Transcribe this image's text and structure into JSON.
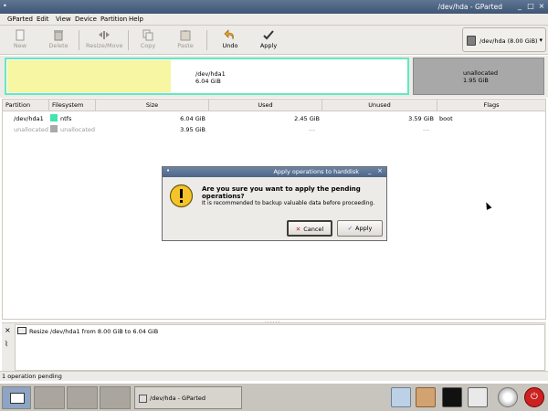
{
  "window": {
    "title": "/dev/hda - GParted"
  },
  "menu": [
    "GParted",
    "Edit",
    "View",
    "Device",
    "Partition",
    "Help"
  ],
  "toolbar": {
    "new": "New",
    "delete": "Delete",
    "resize": "Resize/Move",
    "copy": "Copy",
    "paste": "Paste",
    "undo": "Undo",
    "apply": "Apply"
  },
  "device_selector": {
    "label": "/dev/hda   (8.00 GiB)"
  },
  "graph": {
    "part1": {
      "name": "/dev/hda1",
      "size": "6.04 GiB",
      "used_fraction": 0.41
    },
    "part2": {
      "name": "unallocated",
      "size": "1.95 GiB"
    }
  },
  "table": {
    "headers": [
      "Partition",
      "Filesystem",
      "Size",
      "Used",
      "Unused",
      "Flags"
    ],
    "rows": [
      {
        "partition": "/dev/hda1",
        "filesystem": "ntfs",
        "size": "6.04 GiB",
        "used": "2.45 GiB",
        "unused": "3.59 GiB",
        "flags": "boot",
        "color": "#42e5ac"
      },
      {
        "partition": "unallocated",
        "filesystem": "unallocated",
        "size": "3.95 GiB",
        "used": "---",
        "unused": "---",
        "flags": "",
        "color": "#a9a9a9"
      }
    ]
  },
  "operations": [
    {
      "text": "Resize /dev/hda1 from 8.00 GiB to 6.04 GiB"
    }
  ],
  "status": "1 operation pending",
  "taskbar": {
    "task": "/dev/hda - GParted"
  },
  "dialog": {
    "title": "Apply operations to harddisk",
    "question": "Are you sure you want to apply the pending operations?",
    "detail": "It is recommended to backup valuable data before proceeding.",
    "cancel": "Cancel",
    "apply": "Apply"
  },
  "colors": {
    "accent": "#64e8c2",
    "used": "#f6f6a3",
    "unallocated": "#a8a8a8",
    "ntfs": "#42e5ac"
  }
}
